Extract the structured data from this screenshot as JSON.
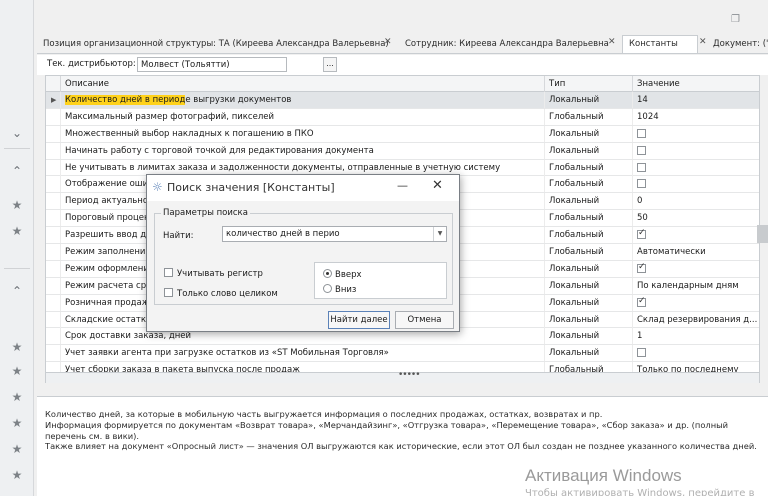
{
  "window": {
    "restore_glyph": "❐"
  },
  "left_rail": {
    "icons": [
      "chevron-down-icon",
      "chevron-up-icon",
      "star-icon",
      "star-icon",
      "chevron-up-icon",
      "star-icon",
      "star-icon",
      "star-icon",
      "star-icon",
      "star-icon",
      "star-icon"
    ]
  },
  "tabs": [
    {
      "label": "Позиция организационной структуры: ТА (Киреева Александра Валерьевна)",
      "active": false
    },
    {
      "label": "Сотрудник: Киреева Александра Валерьевна",
      "active": false
    },
    {
      "label": "Константы",
      "active": true
    },
    {
      "label": "Документ: ('",
      "active": false
    }
  ],
  "filter": {
    "label": "Тек. дистрибьютор:",
    "value": "Молвест (Тольятти)",
    "button": "..."
  },
  "grid": {
    "columns": [
      "Описание",
      "Тип",
      "Значение"
    ],
    "rows": [
      {
        "desc_hl": "Количество дней в период",
        "desc": "е выгрузки документов",
        "type": "Локальный",
        "value": "14",
        "selected": true
      },
      {
        "desc": "Максимальный размер фотографий, пикселей",
        "type": "Глобальный",
        "value": "1024"
      },
      {
        "desc": "Множественный выбор накладных к погашению в ПКО",
        "type": "Локальный",
        "check": false
      },
      {
        "desc": "Начинать работу с торговой точкой для редактирования документа",
        "type": "Локальный",
        "check": false
      },
      {
        "desc": "Не учитывать в лимитах заказа и задолженности документы, отправленные в учетную систему",
        "type": "Глобальный",
        "check": false
      },
      {
        "desc": "Отображение ошиб",
        "type": "Глобальный",
        "check": false
      },
      {
        "desc": "Период актуальнос",
        "type": "Локальный",
        "value": "0"
      },
      {
        "desc": "Пороговый процент",
        "type": "Глобальный",
        "value": "50"
      },
      {
        "desc": "Разрешить ввод до",
        "type": "Глобальный",
        "check": true
      },
      {
        "desc": "Режим заполнения",
        "type": "Глобальный",
        "value": "Автоматически"
      },
      {
        "desc": "Режим оформления",
        "type": "Локальный",
        "check": true
      },
      {
        "desc": "Режим расчета сро",
        "type": "Локальный",
        "value": "По календарным дням"
      },
      {
        "desc": "Розничная продажа",
        "type": "Локальный",
        "check": true
      },
      {
        "desc": "Складские остатки",
        "type": "Локальный",
        "value": "Склад резервирования д..."
      },
      {
        "desc": "Срок доставки заказа, дней",
        "type": "Локальный",
        "value": "1"
      },
      {
        "desc": "Учет заявки агента при загрузке остатков из «ST Мобильная Торговля»",
        "type": "Локальный",
        "check": false
      },
      {
        "desc": "Учет сборки заказа в пакета выпуска после продаж",
        "type": "Глобальный",
        "value": "Только по последнему"
      }
    ]
  },
  "description": {
    "lines": [
      "Количество дней, за которые в мобильную часть выгружается информация о последних продажах, остатках, возвратах и пр.",
      "Информация формируется по документам «Возврат товара», «Мерчандайзинг», «Отгрузка товара», «Перемещение товара», «Сбор заказа» и др. (полный перечень см. в вики).",
      "Также влияет на документ «Опросный лист» — значения ОЛ выгружаются как исторические, если этот ОЛ был создан не позднее указанного количества дней."
    ]
  },
  "watermark": {
    "title": "Активация Windows",
    "subtitle": "Чтобы активировать Windows, перейдите в раздел"
  },
  "dialog": {
    "title": "Поиск значения [Константы]",
    "group_label": "Параметры поиска",
    "find_label": "Найти:",
    "find_value": "количество дней в перио",
    "match_case": "Учитывать регистр",
    "whole_word": "Только слово целиком",
    "dir_up": "Вверх",
    "dir_down": "Вниз",
    "find_next": "Найти далее",
    "cancel": "Отмена"
  }
}
